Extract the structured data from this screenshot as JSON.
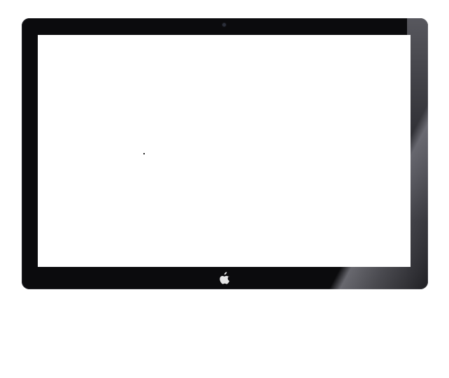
{
  "device": {
    "type": "monitor",
    "bezel_color": "#0b0b0d",
    "screen_color": "#ffffff",
    "logo_icon": "apple-logo-icon",
    "logo_color": "#e6e6e6",
    "camera_icon": "camera-icon"
  }
}
